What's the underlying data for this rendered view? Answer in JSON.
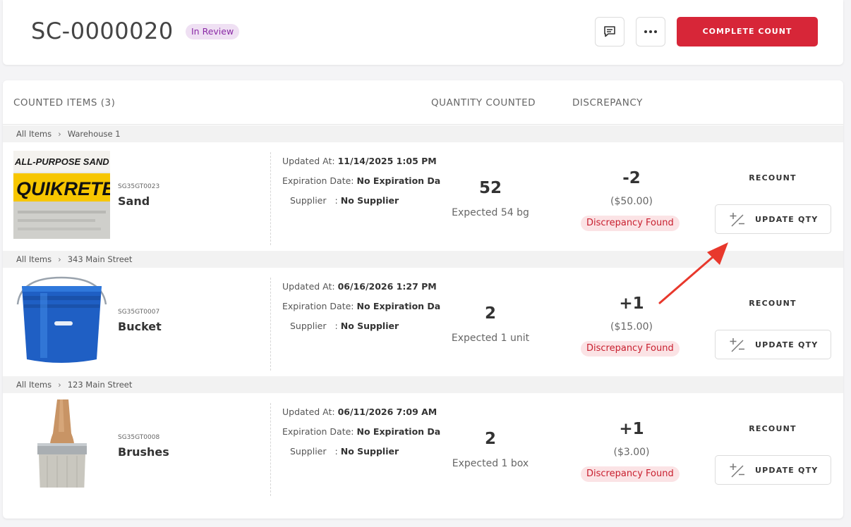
{
  "header": {
    "title": "SC-0000020",
    "status": "In Review",
    "complete_label": "COMPLETE COUNT"
  },
  "list": {
    "col_items": "COUNTED ITEMS (3)",
    "col_qty": "QUANTITY COUNTED",
    "col_disc": "DISCREPANCY",
    "rows": [
      {
        "crumb_root": "All Items",
        "crumb_location": "Warehouse 1",
        "sku": "SG35GT0023",
        "name": "Sand",
        "updated_label": "Updated At:",
        "updated": "11/14/2025 1:05 PM",
        "expiration_label": "Expiration Date:",
        "expiration": "No Expiration Da",
        "supplier_label": "Supplier",
        "supplier": "No Supplier",
        "qty": "52",
        "expected": "Expected 54 bg",
        "discrepancy": "-2",
        "amount": "($50.00)",
        "badge": "Discrepancy Found",
        "recount": "RECOUNT",
        "update": "UPDATE QTY"
      },
      {
        "crumb_root": "All Items",
        "crumb_location": "343 Main Street",
        "sku": "SG35GT0007",
        "name": "Bucket",
        "updated_label": "Updated At:",
        "updated": "06/16/2026 1:27 PM",
        "expiration_label": "Expiration Date:",
        "expiration": "No Expiration Da",
        "supplier_label": "Supplier",
        "supplier": "No Supplier",
        "qty": "2",
        "expected": "Expected 1 unit",
        "discrepancy": "+1",
        "amount": "($15.00)",
        "badge": "Discrepancy Found",
        "recount": "RECOUNT",
        "update": "UPDATE QTY"
      },
      {
        "crumb_root": "All Items",
        "crumb_location": "123 Main Street",
        "sku": "SG35GT0008",
        "name": "Brushes",
        "updated_label": "Updated At:",
        "updated": "06/11/2026 7:09 AM",
        "expiration_label": "Expiration Date:",
        "expiration": "No Expiration Da",
        "supplier_label": "Supplier",
        "supplier": "No Supplier",
        "qty": "2",
        "expected": "Expected 1 box",
        "discrepancy": "+1",
        "amount": "($3.00)",
        "badge": "Discrepancy Found",
        "recount": "RECOUNT",
        "update": "UPDATE QTY"
      }
    ]
  },
  "sand_bag_text": {
    "line1": "ALL-PURPOSE SAND",
    "brand": "QUIKRETE"
  },
  "colors": {
    "primary_red": "#d72638",
    "badge_purple_bg": "#efe0f3",
    "badge_purple_text": "#8a2aa6",
    "badge_red_bg": "#fbe3e5",
    "badge_red_text": "#c8202f"
  },
  "icons": [
    "comment-icon",
    "more-dots-icon",
    "plus-minus-icon",
    "annotation-arrow"
  ]
}
